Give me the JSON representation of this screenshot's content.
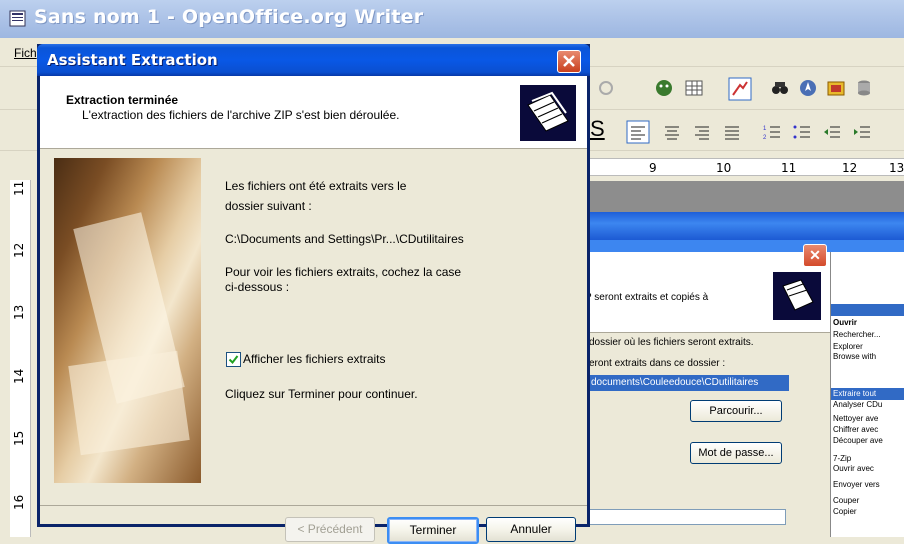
{
  "background_app": {
    "title": "Sans nom 1 - OpenOffice.org Writer",
    "menu_first": "Fich",
    "ruler_numbers": [
      "9",
      "10",
      "11",
      "12",
      "13"
    ],
    "vertical_ruler_numbers": [
      "11",
      "12",
      "13",
      "14",
      "15",
      "16"
    ]
  },
  "background_dialog": {
    "fragment_text_1": "P seront extraits et copiés à",
    "fragment_text_2": "dossier où les fichiers seront extraits.",
    "fragment_text_3": "eront extraits dans ce dossier :",
    "path_value": "documents\\Couleedouce\\CDutilitaires",
    "browse_label": "Parcourir...",
    "password_label": "Mot de passe...",
    "context_menu": [
      "Ouvrir",
      "Rechercher...",
      "Explorer",
      "Browse with",
      "Extraire tout",
      "Analyser CDu",
      "Nettoyer ave",
      "Chiffrer avec",
      "Découper ave",
      "7-Zip",
      "Ouvrir avec",
      "Envoyer vers",
      "Couper",
      "Copier"
    ]
  },
  "dialog": {
    "title": "Assistant Extraction",
    "header_title": "Extraction terminée",
    "header_subtitle": "L'extraction des fichiers de l'archive ZIP s'est bien déroulée.",
    "line1": "Les fichiers ont été extraits vers le",
    "line2": "dossier suivant :",
    "path": "C:\\Documents and Settings\\Pr...\\CDutilitaires",
    "line3": "Pour voir les fichiers extraits, cochez la case",
    "line4": "ci-dessous :",
    "checkbox_label": "Afficher les fichiers extraits",
    "checkbox_checked": true,
    "line5": "Cliquez sur Terminer pour continuer.",
    "btn_prev": "< Précédent",
    "btn_finish": "Terminer",
    "btn_cancel": "Annuler"
  },
  "colors": {
    "titlebar": "#0a55d8",
    "close_button": "#d44a2b",
    "dialog_face": "#ece9d8"
  }
}
